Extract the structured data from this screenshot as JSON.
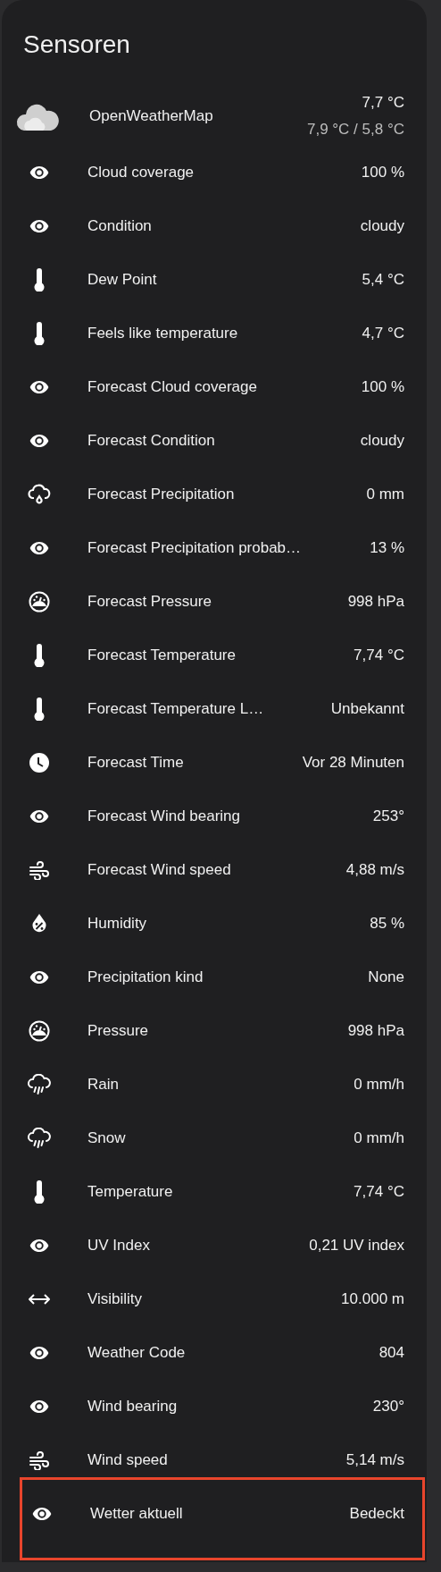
{
  "card": {
    "title": "Sensoren"
  },
  "weather": {
    "name": "OpenWeatherMap",
    "temperature": "7,7 °C",
    "range": "7,9 °C / 5,8 °C"
  },
  "rows": [
    {
      "kind": "eye",
      "name": "Cloud coverage",
      "value": "100 %",
      "highlighted": false
    },
    {
      "kind": "eye",
      "name": "Condition",
      "value": "cloudy",
      "highlighted": false
    },
    {
      "kind": "thermometer",
      "name": "Dew Point",
      "value": "5,4 °C",
      "highlighted": false
    },
    {
      "kind": "thermometer",
      "name": "Feels like temperature",
      "value": "4,7 °C",
      "highlighted": false
    },
    {
      "kind": "eye",
      "name": "Forecast Cloud coverage",
      "value": "100 %",
      "highlighted": false
    },
    {
      "kind": "eye",
      "name": "Forecast Condition",
      "value": "cloudy",
      "highlighted": false
    },
    {
      "kind": "precipitation",
      "name": "Forecast Precipitation",
      "value": "0 mm",
      "highlighted": false
    },
    {
      "kind": "eye",
      "name": "Forecast Precipitation probab…",
      "value": "13 %",
      "highlighted": false
    },
    {
      "kind": "gauge",
      "name": "Forecast Pressure",
      "value": "998 hPa",
      "highlighted": false
    },
    {
      "kind": "thermometer",
      "name": "Forecast Temperature",
      "value": "7,74 °C",
      "highlighted": false
    },
    {
      "kind": "thermometer",
      "name": "Forecast Temperature L…",
      "value": "Unbekannt",
      "highlighted": false
    },
    {
      "kind": "clock",
      "name": "Forecast Time",
      "value": "Vor 28 Minuten",
      "highlighted": false
    },
    {
      "kind": "eye",
      "name": "Forecast Wind bearing",
      "value": "253°",
      "highlighted": false
    },
    {
      "kind": "wind",
      "name": "Forecast Wind speed",
      "value": "4,88 m/s",
      "highlighted": false
    },
    {
      "kind": "humidity",
      "name": "Humidity",
      "value": "85 %",
      "highlighted": false
    },
    {
      "kind": "eye",
      "name": "Precipitation kind",
      "value": "None",
      "highlighted": false
    },
    {
      "kind": "gauge",
      "name": "Pressure",
      "value": "998 hPa",
      "highlighted": false
    },
    {
      "kind": "rain",
      "name": "Rain",
      "value": "0 mm/h",
      "highlighted": false
    },
    {
      "kind": "rain",
      "name": "Snow",
      "value": "0 mm/h",
      "highlighted": false
    },
    {
      "kind": "thermometer",
      "name": "Temperature",
      "value": "7,74 °C",
      "highlighted": false
    },
    {
      "kind": "eye",
      "name": "UV Index",
      "value": "0,21 UV index",
      "highlighted": false
    },
    {
      "kind": "arrows",
      "name": "Visibility",
      "value": "10.000 m",
      "highlighted": false
    },
    {
      "kind": "eye",
      "name": "Weather Code",
      "value": "804",
      "highlighted": false
    },
    {
      "kind": "eye",
      "name": "Wind bearing",
      "value": "230°",
      "highlighted": false
    },
    {
      "kind": "wind",
      "name": "Wind speed",
      "value": "5,14 m/s",
      "highlighted": false
    },
    {
      "kind": "eye",
      "name": "Wetter aktuell",
      "value": "Bedeckt",
      "highlighted": true
    }
  ]
}
